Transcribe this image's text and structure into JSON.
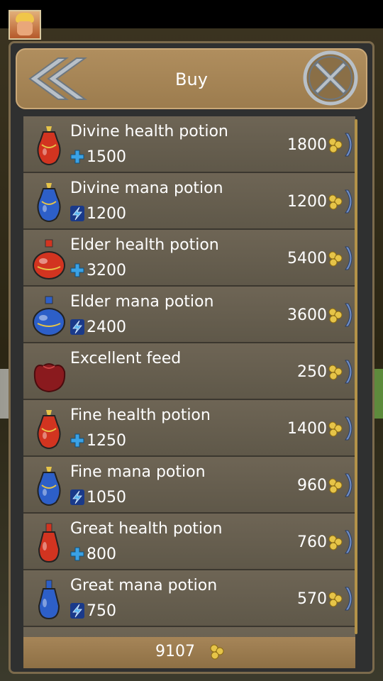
{
  "header": {
    "title": "Buy"
  },
  "colors": {
    "health": "#d23420",
    "mana": "#2d5fc8",
    "gold": "#e6c448",
    "stat_blue": "#3aa2e6"
  },
  "items": [
    {
      "name": "Divine health potion",
      "stat_icon": "plus-icon",
      "stat": "1500",
      "price": "1800",
      "icon": "divine-health-potion-icon",
      "kind": "health"
    },
    {
      "name": "Divine mana potion",
      "stat_icon": "lightning-icon",
      "stat": "1200",
      "price": "1200",
      "icon": "divine-mana-potion-icon",
      "kind": "mana"
    },
    {
      "name": "Elder health potion",
      "stat_icon": "plus-icon",
      "stat": "3200",
      "price": "5400",
      "icon": "elder-health-potion-icon",
      "kind": "health"
    },
    {
      "name": "Elder mana potion",
      "stat_icon": "lightning-icon",
      "stat": "2400",
      "price": "3600",
      "icon": "elder-mana-potion-icon",
      "kind": "mana"
    },
    {
      "name": "Excellent feed",
      "stat_icon": "",
      "stat": "",
      "price": "250",
      "icon": "feed-bag-icon",
      "kind": "feed"
    },
    {
      "name": "Fine health potion",
      "stat_icon": "plus-icon",
      "stat": "1250",
      "price": "1400",
      "icon": "fine-health-potion-icon",
      "kind": "health"
    },
    {
      "name": "Fine mana potion",
      "stat_icon": "lightning-icon",
      "stat": "1050",
      "price": "960",
      "icon": "fine-mana-potion-icon",
      "kind": "mana"
    },
    {
      "name": "Great health potion",
      "stat_icon": "plus-icon",
      "stat": "800",
      "price": "760",
      "icon": "great-health-potion-icon",
      "kind": "health"
    },
    {
      "name": "Great mana potion",
      "stat_icon": "lightning-icon",
      "stat": "750",
      "price": "570",
      "icon": "great-mana-potion-icon",
      "kind": "mana"
    }
  ],
  "footer": {
    "gold_total": "9107"
  }
}
